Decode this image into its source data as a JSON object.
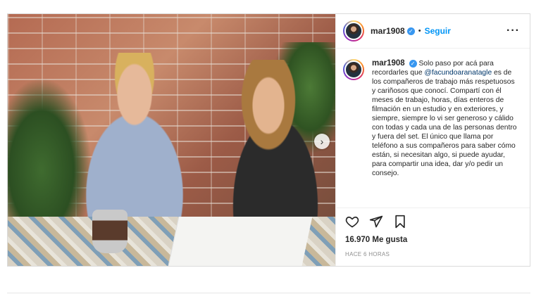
{
  "post": {
    "username": "mar1908",
    "follow_label": "Seguir",
    "separator": "•",
    "caption": {
      "username": "mar1908",
      "before_mention": "Solo paso por acá para recordarles que ",
      "mention": "@facundoaranatagle",
      "after_mention": " es de los compañeros de trabajo más respetuosos y cariñosos que conocí. Compartí con él meses de trabajo, horas, días enteros de filmación en un estudio y en exteriores, y siempre, siempre lo vi ser generoso y cálido con todas y cada una de las personas dentro y fuera del set. El único que llama por teléfono a sus compañeros para saber cómo están, si necesitan algo, si puede ayudar, para compartir una idea, dar y/o pedir un consejo."
    },
    "likes": "16.970 Me gusta",
    "timestamp": "HACE 6 HORAS"
  },
  "icons": {
    "verified": "verified-badge-icon",
    "more": "more-options-icon",
    "like": "heart-icon",
    "share": "paper-plane-icon",
    "save": "bookmark-icon",
    "next": "chevron-right-icon"
  },
  "colors": {
    "accent": "#0095f6",
    "verified": "#3897f0",
    "mention": "#00376b",
    "muted": "#8e8e8e"
  }
}
